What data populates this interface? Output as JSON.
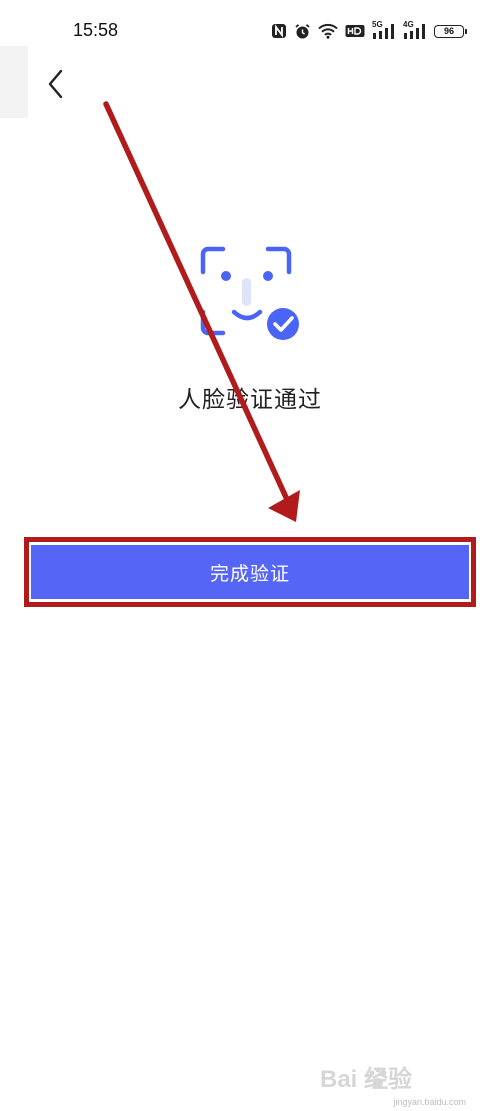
{
  "status_bar": {
    "time": "15:58",
    "icons": [
      "nfc-icon",
      "alarm-icon",
      "wifi-icon",
      "hd-icon",
      "signal-5g-icon",
      "signal-4g-icon"
    ],
    "net_5g": "5G",
    "net_4g": "4G",
    "battery": "96"
  },
  "nav": {
    "back_icon": "chevron-left-icon"
  },
  "face_verify": {
    "icon": "face-scan-check-icon",
    "accent_color": "#4a64f5",
    "result_text": "人脸验证通过"
  },
  "actions": {
    "complete_label": "完成验证",
    "button_color": "#5566f6"
  },
  "annotation": {
    "color": "#b11b1b"
  },
  "watermark": {
    "brand": "Bai  经验",
    "sub": "jingyan.baidu.com"
  }
}
